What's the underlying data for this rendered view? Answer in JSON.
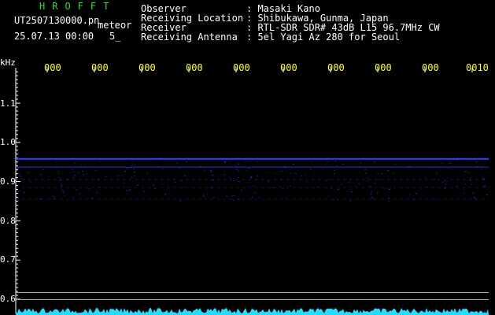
{
  "header": {
    "brand": "HROFFT",
    "file_name": "UT2507130000.pn",
    "mode": "meteor",
    "date_time": "25.07.13 00:00",
    "count": "5_"
  },
  "station_info": [
    {
      "label": "Observer",
      "value": ": Masaki Kano"
    },
    {
      "label": "Receiving Location",
      "value": ": Shibukawa, Gunma, Japan"
    },
    {
      "label": "Receiver",
      "value": ": RTL-SDR SDR# 43dB L15 96.7MHz CW"
    },
    {
      "label": "Receiving Antenna",
      "value": ": 5el Yagi Az 280 for Seoul"
    }
  ],
  "y_axis": {
    "unit": "kHz",
    "labels": [
      "1.1",
      "1.0",
      "0.9",
      "0.8",
      "0.7",
      "0.6"
    ]
  },
  "x_axis": {
    "labels": [
      "000",
      "000",
      "000",
      "000",
      "000",
      "000",
      "000",
      "000",
      "000",
      "0010"
    ]
  },
  "colors": {
    "background": "#000000",
    "header_text": "#ffffff",
    "brand_text": "#33dd33",
    "file_text": "#ffffff",
    "tick_labels": "#ffff44",
    "signal_trace": "#3340ff",
    "noise_floor": "#22ddff"
  },
  "chart_data": {
    "type": "heatmap",
    "title": "",
    "ylabel": "kHz",
    "ylim": [
      0.58,
      1.18
    ],
    "traces": [
      {
        "freq_khz": 0.958,
        "intensity": 1.0
      },
      {
        "freq_khz": 0.937,
        "intensity": 0.7
      },
      {
        "freq_khz": 0.905,
        "intensity": 0.35
      },
      {
        "freq_khz": 0.885,
        "intensity": 0.3
      },
      {
        "freq_khz": 0.855,
        "intensity": 0.3
      }
    ],
    "reference_lines_khz": [
      0.617,
      0.599
    ]
  }
}
